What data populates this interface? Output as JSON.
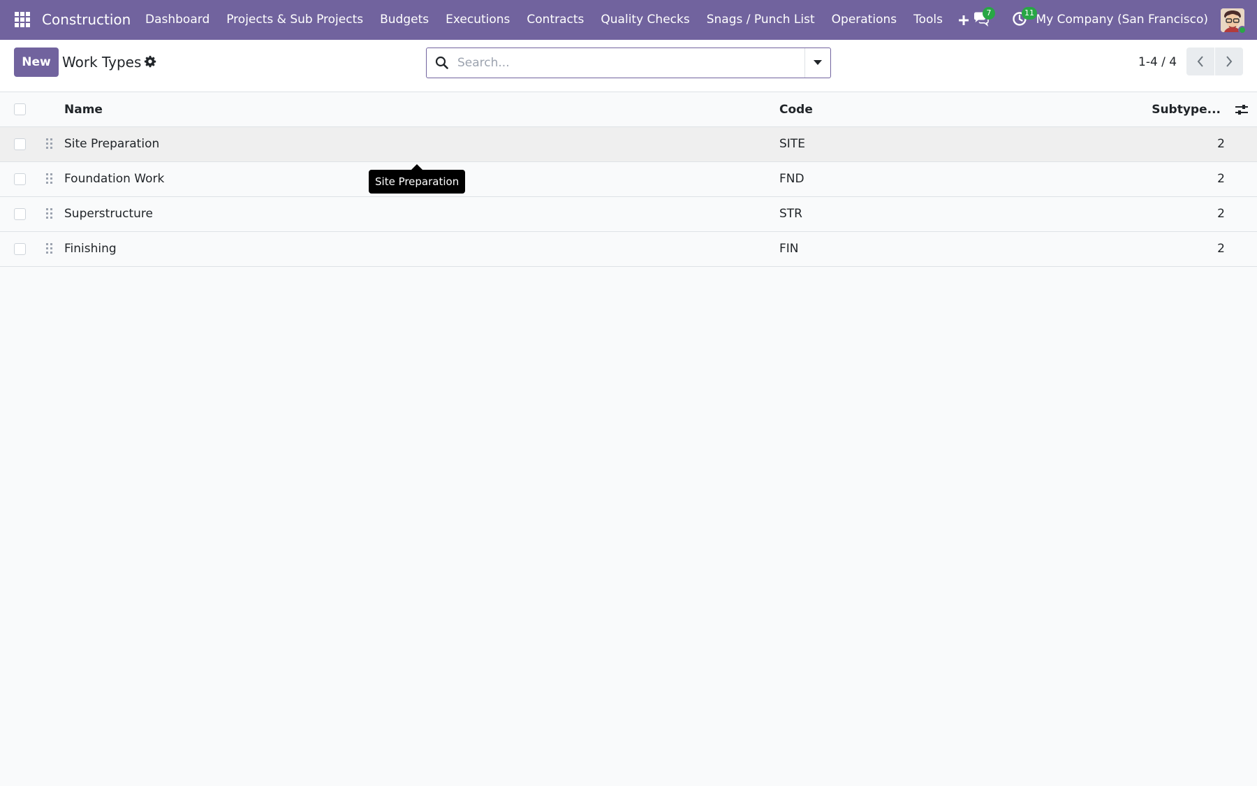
{
  "navbar": {
    "brand": "Construction",
    "menu": [
      "Dashboard",
      "Projects & Sub Projects",
      "Budgets",
      "Executions",
      "Contracts",
      "Quality Checks",
      "Snags / Punch List",
      "Operations",
      "Tools"
    ],
    "messages_count": "7",
    "activities_count": "11",
    "company": "My Company (San Francisco)",
    "color": "#71639e",
    "badge_color": "#28a745"
  },
  "control_panel": {
    "new_label": "New",
    "title": "Work Types",
    "search_placeholder": "Search...",
    "pager": "1-4 / 4"
  },
  "table": {
    "columns": {
      "name": "Name",
      "code": "Code",
      "subtypes": "Subtype..."
    },
    "rows": [
      {
        "name": "Site Preparation",
        "code": "SITE",
        "subtypes": "2"
      },
      {
        "name": "Foundation Work",
        "code": "FND",
        "subtypes": "2"
      },
      {
        "name": "Superstructure",
        "code": "STR",
        "subtypes": "2"
      },
      {
        "name": "Finishing",
        "code": "FIN",
        "subtypes": "2"
      }
    ]
  },
  "tooltip": {
    "text": "Site Preparation"
  }
}
